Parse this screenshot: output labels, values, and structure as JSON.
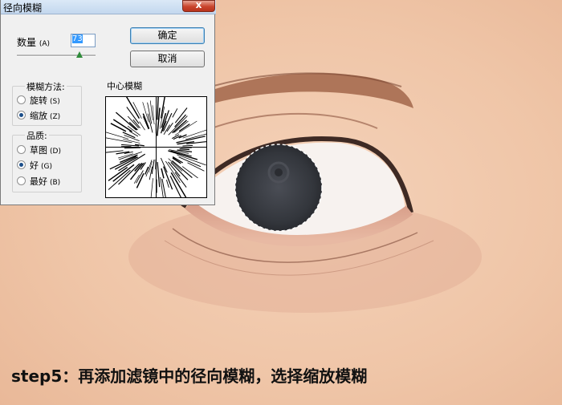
{
  "dialog": {
    "title": "径向模糊",
    "close_symbol": "x",
    "amount_label": "数量",
    "amount_key": "(A)",
    "amount_value": "73",
    "ok_label": "确定",
    "cancel_label": "取消",
    "method": {
      "title": "模糊方法:",
      "options": [
        {
          "label": "旋转",
          "key": "(S)",
          "selected": false
        },
        {
          "label": "缩放",
          "key": "(Z)",
          "selected": true
        }
      ]
    },
    "quality": {
      "title": "品质:",
      "options": [
        {
          "label": "草图",
          "key": "(D)",
          "selected": false
        },
        {
          "label": "好",
          "key": "(G)",
          "selected": true
        },
        {
          "label": "最好",
          "key": "(B)",
          "selected": false
        }
      ]
    },
    "center_label": "中心模糊"
  },
  "caption": "step5：再添加滤镜中的径向模糊，选择缩放模糊",
  "colors": {
    "skin": "#f1c9ad",
    "iris": "#36393f",
    "dialog_bg": "#f0f0f0",
    "close_red": "#c9452d"
  }
}
